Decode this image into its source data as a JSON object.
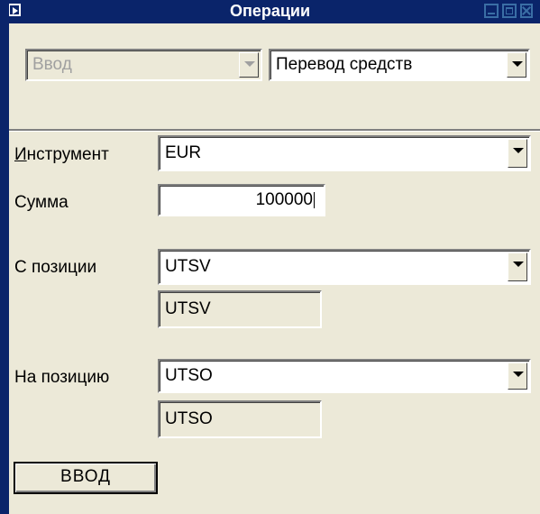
{
  "window": {
    "title": "Операции"
  },
  "top": {
    "mode_value": "Ввод",
    "operation_value": "Перевод средств"
  },
  "form": {
    "instrument_label": "Инструмент",
    "instrument_value": "EUR",
    "amount_label": "Сумма",
    "amount_value": "100000",
    "from_label": "С позиции",
    "from_value": "UTSV",
    "from_readonly": "UTSV",
    "to_label": "На позицию",
    "to_value": "UTSO",
    "to_readonly": "UTSO"
  },
  "actions": {
    "submit_label": "ВВОД"
  },
  "icons": {
    "system": "window-menu-icon",
    "minimize": "minimize-icon",
    "maximize": "maximize-icon",
    "close": "close-icon",
    "dropdown": "chevron-down-icon"
  },
  "colors": {
    "titlebar": "#0a246a",
    "window_bg": "#ece9d8",
    "disabled_text": "#a0a0a0"
  }
}
